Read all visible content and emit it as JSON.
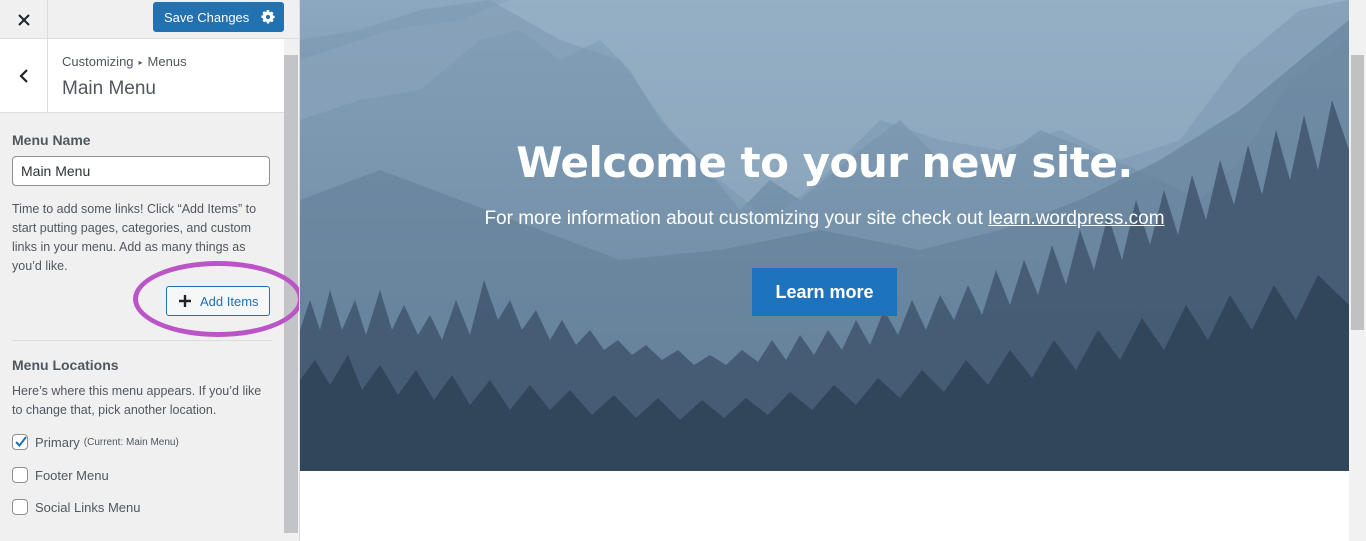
{
  "topbar": {
    "close_icon": "close-icon",
    "save_label": "Save Changes",
    "save_icon": "gear-icon"
  },
  "section": {
    "back_icon": "chevron-left-icon",
    "breadcrumb_parent": "Customizing",
    "breadcrumb_separator": "▸",
    "breadcrumb_current": "Menus",
    "title": "Main Menu"
  },
  "menu_name": {
    "label": "Menu Name",
    "value": "Main Menu",
    "help": "Time to add some links! Click “Add Items” to start putting pages, categories, and custom links in your menu. Add as many things as you’d like."
  },
  "add_items": {
    "label": "Add Items",
    "icon": "plus-icon",
    "highlight_color": "#bb55c7"
  },
  "locations": {
    "label": "Menu Locations",
    "help": "Here’s where this menu appears. If you’d like to change that, pick another location.",
    "items": [
      {
        "label": "Primary",
        "note": "(Current: Main Menu)",
        "checked": true
      },
      {
        "label": "Footer Menu",
        "note": "",
        "checked": false
      },
      {
        "label": "Social Links Menu",
        "note": "",
        "checked": false
      }
    ]
  },
  "preview": {
    "title": "Welcome to your new site.",
    "subtitle": "For more information about customizing your site check out",
    "link_text": "learn.wordpress.com",
    "button_label": "Learn more",
    "button_color": "#1e73be"
  },
  "colors": {
    "accent": "#2271b1",
    "sidebar_bg": "#f0f0f1"
  }
}
